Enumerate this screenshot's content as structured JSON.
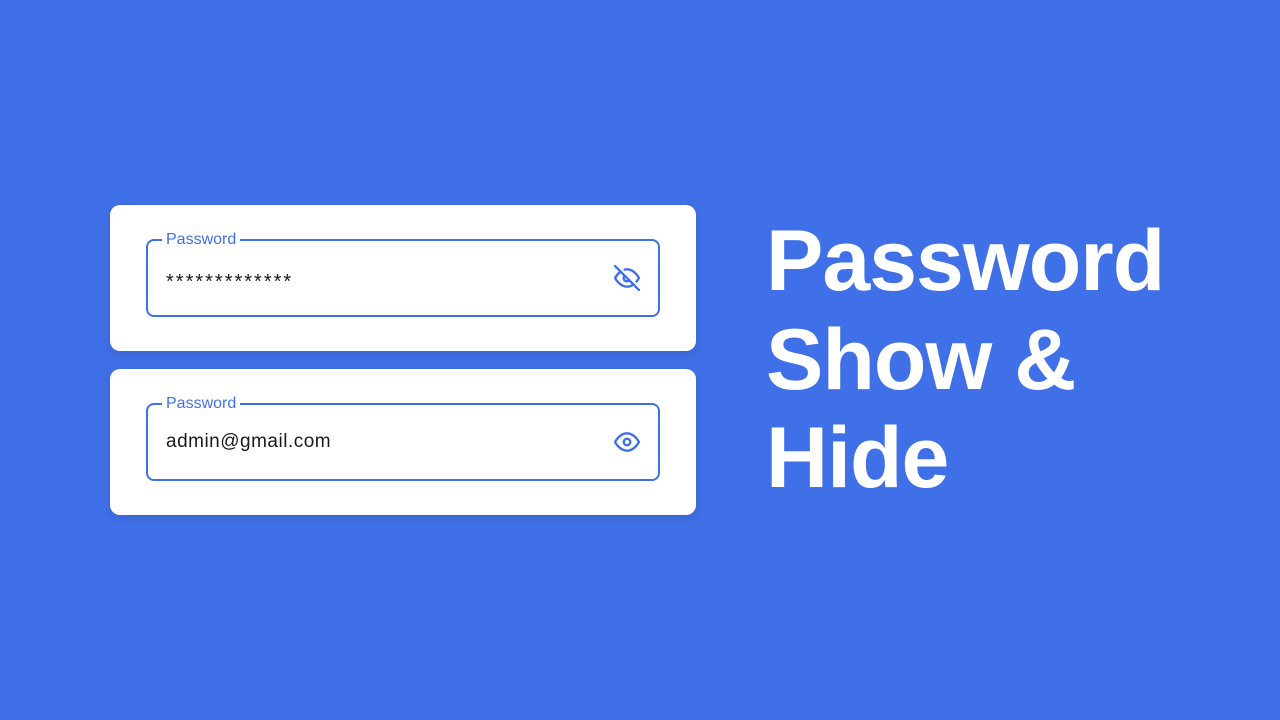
{
  "heading": {
    "line1": "Password",
    "line2": "Show &",
    "line3": "Hide"
  },
  "cards": {
    "hidden": {
      "label": "Password",
      "value": "*************"
    },
    "shown": {
      "label": "Password",
      "value": "admin@gmail.com"
    }
  },
  "colors": {
    "background": "#4070e8",
    "card": "#ffffff",
    "accent": "#4070e8"
  }
}
